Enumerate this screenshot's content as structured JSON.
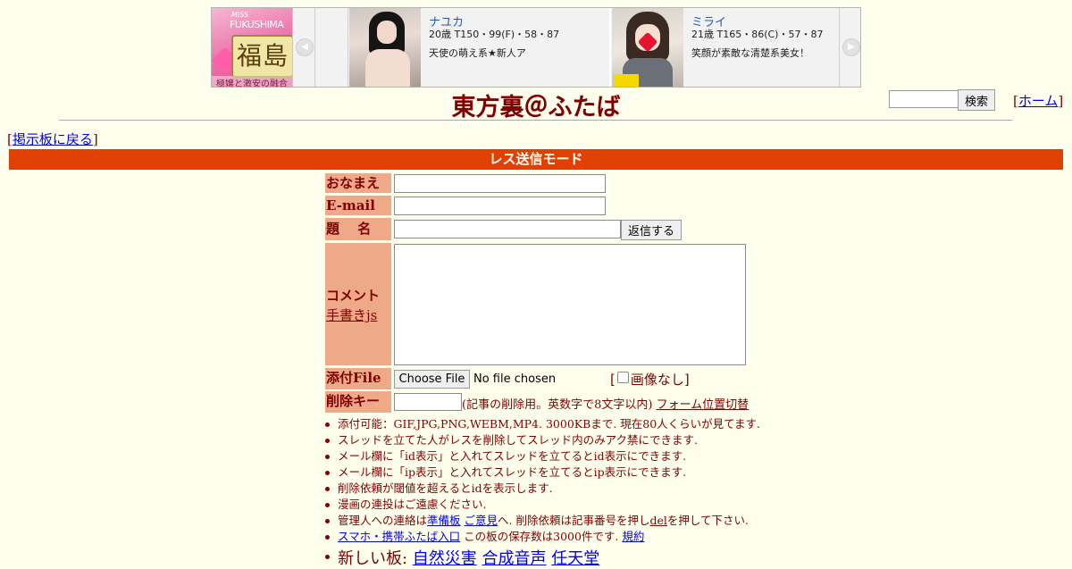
{
  "ad": {
    "logo": {
      "line1": "MISS",
      "line2": "FUKUSHIMA",
      "badge": "福島",
      "tagline": "極嬢と激安の融合"
    },
    "cards": [
      {
        "name": "ナユカ",
        "stats": "20歳 T150・99(F)・58・87",
        "desc": "天使の萌え系★新人ア"
      },
      {
        "name": "ミライ",
        "stats": "21歳 T165・86(C)・57・87",
        "desc": "笑顔が素敵な清楚系美女！"
      }
    ],
    "prev_arrow": "◀",
    "next_arrow": "▶"
  },
  "header": {
    "title": "東方裏＠ふたば",
    "search_button": "検索",
    "home_label": "ホーム"
  },
  "nav": {
    "back_label": "掲示板に戻る"
  },
  "mode_bar": "レス送信モード",
  "form": {
    "name_label": "おなまえ",
    "email_label": "E-mail",
    "subject_label": "題　 名",
    "submit_label": "返信する",
    "comment_label": "コメント",
    "tegaki_label": "手書きjs",
    "file_label": "添付File",
    "choose_file": "Choose File",
    "no_file": "No file chosen",
    "noimage_label": "画像なし",
    "delkey_label": "削除キー",
    "delkey_note": "(記事の削除用。英数字で8文字以内)",
    "form_toggle": "フォーム位置切替"
  },
  "notes": {
    "n1": "添付可能：GIF,JPG,PNG,WEBM,MP4. 3000KBまで. 現在80人くらいが見てます.",
    "n2": "スレッドを立てた人がレスを削除してスレッド内のみアク禁にできます.",
    "n3": "メール欄に「id表示」と入れてスレッドを立てるとid表示にできます.",
    "n4": "メール欄に「ip表示」と入れてスレッドを立てるとip表示にできます.",
    "n5": "削除依頼が閾値を超えるとidを表示します.",
    "n6": "漫画の連投はご遠慮ください.",
    "n7_pre": "管理人への連絡は",
    "n7_link1": "準備板",
    "n7_link2": "ご意見",
    "n7_mid": "へ. 削除依頼は記事番号を押し",
    "n7_del": "del",
    "n7_post": "を押して下さい.",
    "n8_link": "スマホ・携帯ふたば入口",
    "n8_mid": " この板の保存数は3000件です. ",
    "n8_rules": "規約"
  },
  "new_boards": {
    "label": "新しい板: ",
    "boards": [
      "自然災害",
      "合成音声",
      "任天堂"
    ]
  }
}
